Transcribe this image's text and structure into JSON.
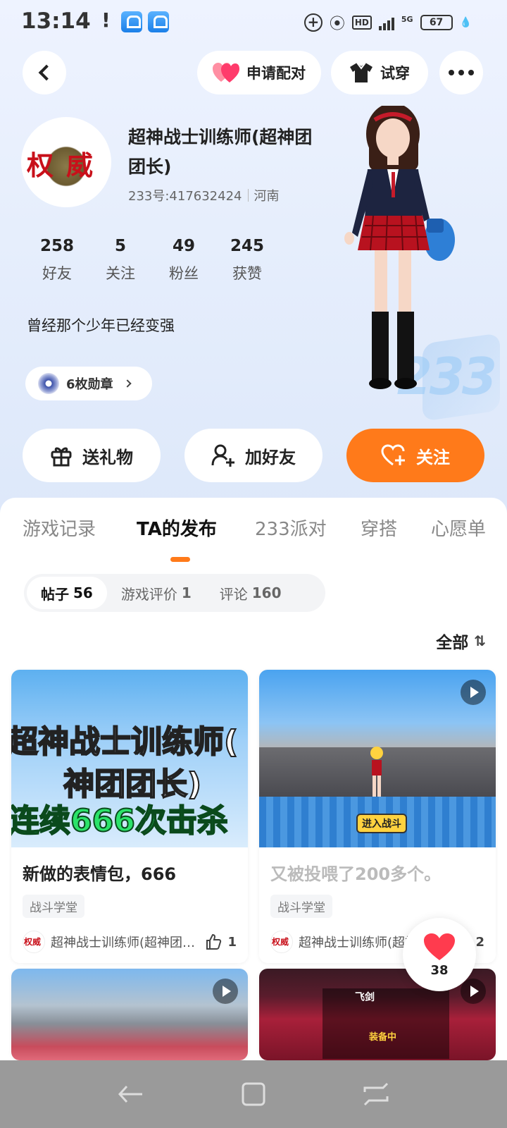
{
  "status_bar": {
    "time": "13:14",
    "alert": "!",
    "battery": "67",
    "network": "5G",
    "hd": "HD"
  },
  "header": {
    "pair_label": "申请配对",
    "try_on_label": "试穿"
  },
  "profile": {
    "nickname": "超神战士训练师(超神团团长)",
    "uid": "233号:417632424",
    "region": "河南",
    "avatar_text": "权威",
    "bio": "曾经那个少年已经变强",
    "medals": "6枚勋章"
  },
  "stats": [
    {
      "num": "258",
      "label": "好友"
    },
    {
      "num": "5",
      "label": "关注"
    },
    {
      "num": "49",
      "label": "粉丝"
    },
    {
      "num": "245",
      "label": "获赞"
    }
  ],
  "actions": {
    "gift": "送礼物",
    "add_friend": "加好友",
    "follow": "关注"
  },
  "tabs": [
    "游戏记录",
    "TA的发布",
    "233派对",
    "穿搭",
    "心愿单"
  ],
  "active_tab": "TA的发布",
  "subtabs": [
    {
      "label": "帖子",
      "count": "56"
    },
    {
      "label": "游戏评价",
      "count": "1"
    },
    {
      "label": "评论",
      "count": "160"
    }
  ],
  "sort_label": "全部",
  "posts": [
    {
      "title": "新做的表情包，666",
      "tag": "战斗学堂",
      "author": "超神战士训练师(超神团团长)",
      "likes": "1",
      "image_text": [
        "超神战士训练师(",
        "神团团长)",
        "连续666次击杀"
      ]
    },
    {
      "title": "又被投喂了200多个。",
      "tag": "战斗学堂",
      "author": "超神战士训练师(超神团团长)",
      "likes": "2",
      "image_text": [
        "进入战斗"
      ]
    },
    {
      "title": "",
      "tag": "",
      "author": "",
      "likes": ""
    },
    {
      "title": "",
      "tag": "",
      "author": "",
      "likes": "",
      "image_text": [
        "飞剑",
        "装备中"
      ]
    }
  ],
  "like_float": {
    "count": "38"
  },
  "colors": {
    "accent": "#ff7a1a",
    "heart": "#ff3b4e"
  }
}
